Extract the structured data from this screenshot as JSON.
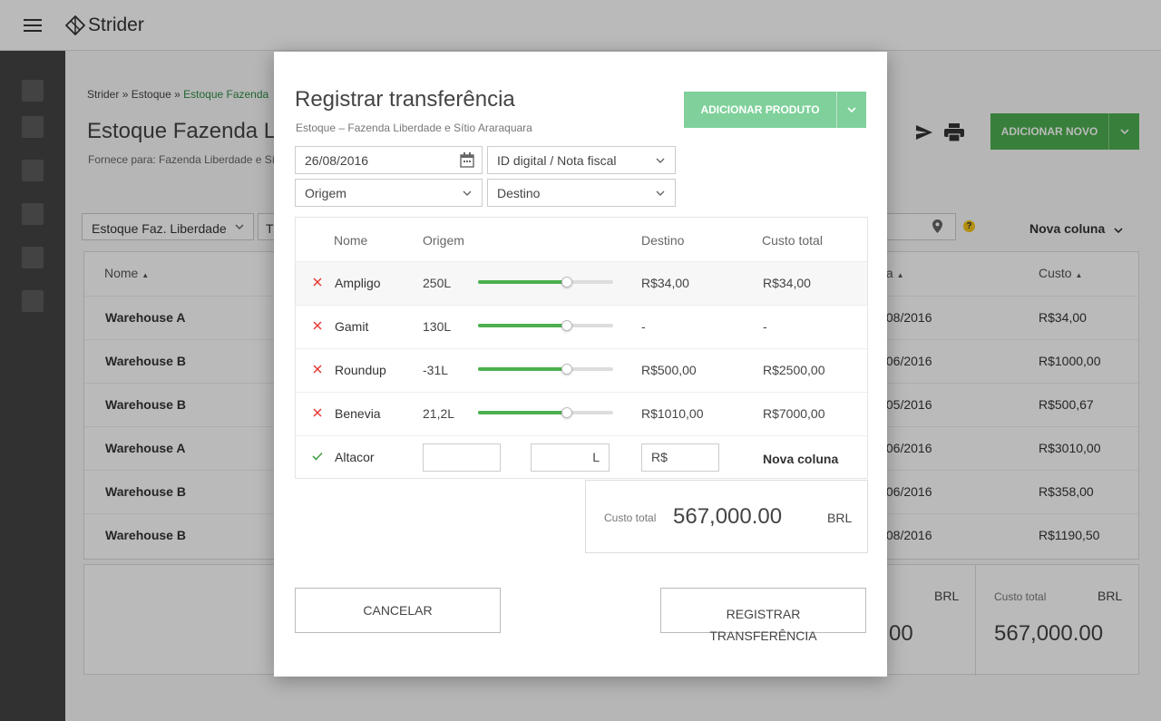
{
  "app": {
    "name": "Strider"
  },
  "background": {
    "breadcrumb": {
      "root": "Strider",
      "sep1": "»",
      "section": "Estoque",
      "sep2": "»",
      "current": "Estoque Fazenda"
    },
    "title": "Estoque Fazenda Li",
    "subtitle": "Fornece para: Fazenda Liberdade e Sítio",
    "add_button": "ADICIONAR NOVO",
    "filter1": "Estoque Faz.  Liberdade",
    "filter2": "T",
    "new_column": "Nova coluna",
    "help": "?",
    "columns": {
      "name": "Nome",
      "date": "ta",
      "cost": "Custo"
    },
    "rows": [
      {
        "name": "Warehouse A",
        "date": "/08/2016",
        "cost": "R$34,00"
      },
      {
        "name": "Warehouse B",
        "date": "/06/2016",
        "cost": "R$1000,00"
      },
      {
        "name": "Warehouse B",
        "date": "/05/2016",
        "cost": "R$500,67"
      },
      {
        "name": "Warehouse A",
        "date": "/06/2016",
        "cost": "R$3010,00"
      },
      {
        "name": "Warehouse B",
        "date": "/06/2016",
        "cost": "R$358,00"
      },
      {
        "name": "Warehouse B",
        "date": "/08/2016",
        "cost": "R$1190,50"
      }
    ],
    "summary": {
      "left_currency": "BRL",
      "left_value": "00",
      "right_label": "Custo total",
      "right_currency": "BRL",
      "right_value": "567,000.00"
    }
  },
  "modal": {
    "title": "Registrar transferência",
    "subtitle": "Estoque – Fazenda Liberdade e Sítio Araraquara",
    "add_product": "ADICIONAR PRODUTO",
    "date": "26/08/2016",
    "doc_select": "ID digital / Nota fiscal",
    "origin_select": "Origem",
    "destination_select": "Destino",
    "columns": {
      "name": "Nome",
      "origin": "Origem",
      "destination": "Destino",
      "total_cost": "Custo total"
    },
    "rows": [
      {
        "name": "Ampligo",
        "origin": "250L",
        "level": 0.66,
        "destination": "R$34,00",
        "total": "R$34,00"
      },
      {
        "name": "Gamit",
        "origin": "130L",
        "level": 0.66,
        "destination": "-",
        "total": "-"
      },
      {
        "name": "Roundup",
        "origin": "-31L",
        "level": 0.66,
        "destination": "R$500,00",
        "total": "R$2500,00"
      },
      {
        "name": "Benevia",
        "origin": "21,2L",
        "level": 0.66,
        "destination": "R$1010,00",
        "total": "R$7000,00"
      }
    ],
    "new_row": {
      "name": "Altacor",
      "unit": "L",
      "currency_prefix": "R$",
      "new_column": "Nova coluna"
    },
    "total": {
      "label": "Custo total",
      "value": "567,000.00",
      "currency": "BRL"
    },
    "cancel": "CANCELAR",
    "register_line1": "REGISTRAR",
    "register_line2": "TRANSFERÊNCIA"
  },
  "colors": {
    "primary": "#4caf50",
    "primary_light": "#7fd09a",
    "remove": "#e53935",
    "confirm": "#43a047",
    "breadcrumb_link": "#2e8b44"
  },
  "icons": [
    "menu-icon",
    "strider-logo-icon",
    "send-icon",
    "print-icon",
    "chevron-down-icon",
    "calendar-icon",
    "close-icon",
    "check-icon",
    "location-pin-icon",
    "help-icon",
    "sort-asc-icon"
  ]
}
